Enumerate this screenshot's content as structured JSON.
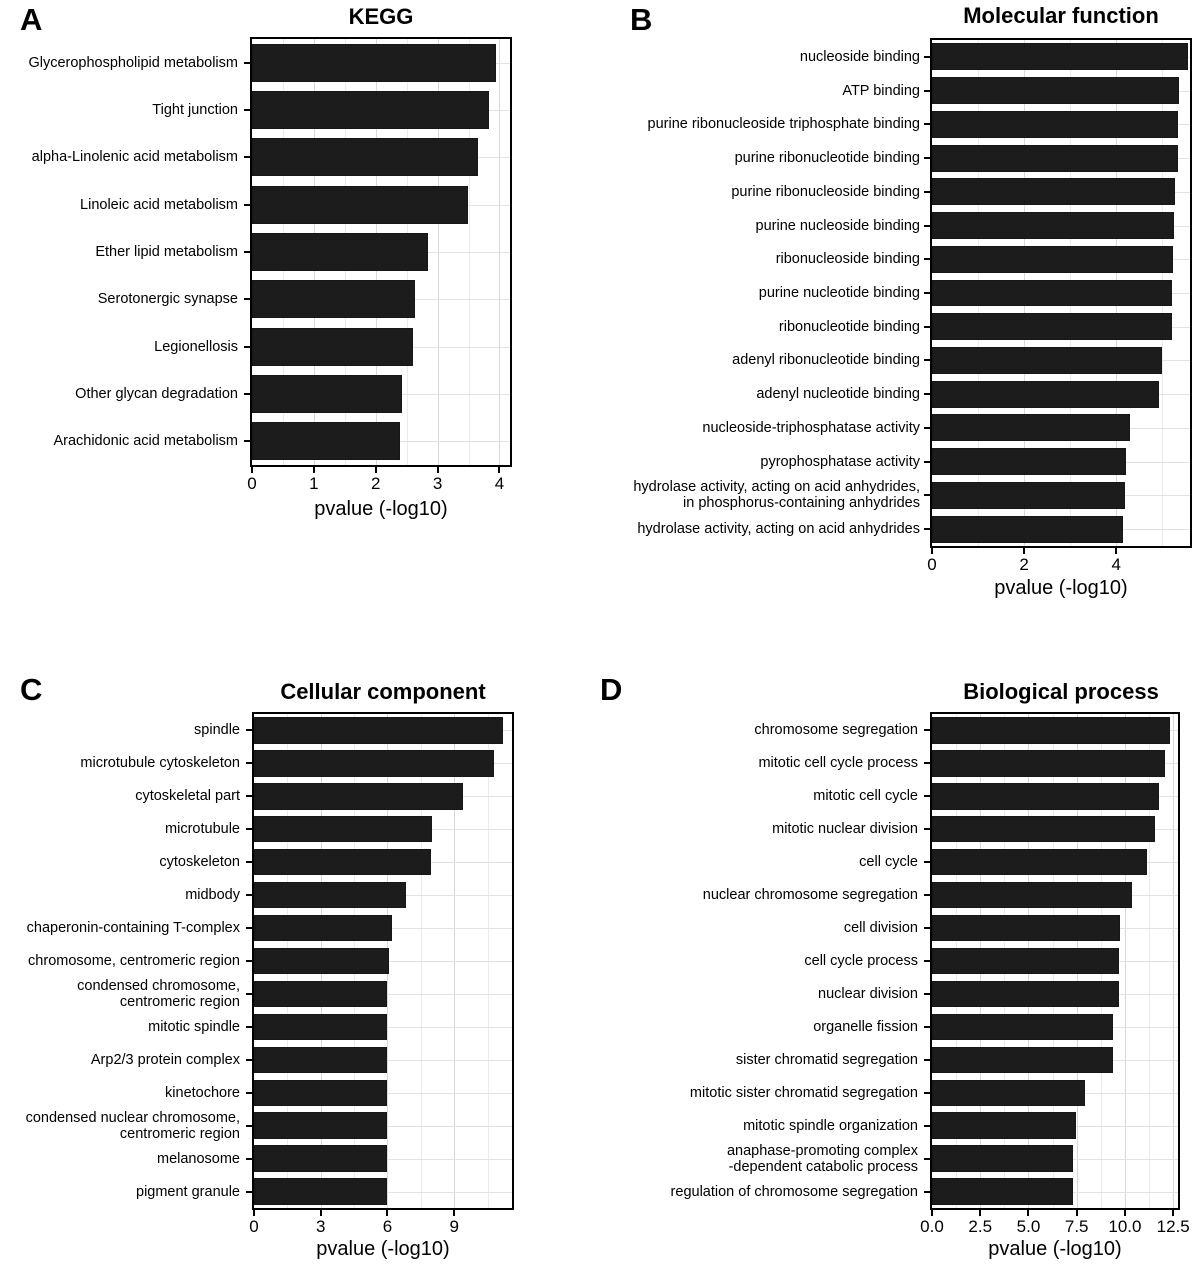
{
  "figure": {
    "panels": [
      {
        "letter": "A",
        "title": "KEGG",
        "xlabel": "pvalue (-log10)"
      },
      {
        "letter": "B",
        "title": "Molecular function",
        "xlabel": "pvalue (-log10)"
      },
      {
        "letter": "C",
        "title": "Cellular component",
        "xlabel": "pvalue (-log10)"
      },
      {
        "letter": "D",
        "title": "Biological process",
        "xlabel": "pvalue (-log10)"
      }
    ]
  },
  "chart_data": [
    {
      "panel": "A",
      "type": "bar",
      "orientation": "horizontal",
      "title": "KEGG",
      "xlabel": "pvalue (-log10)",
      "ylabel": "",
      "xlim": [
        0,
        4.17
      ],
      "xticks": [
        0,
        1,
        2,
        3,
        4
      ],
      "xticklabels": [
        "0",
        "1",
        "2",
        "3",
        "4"
      ],
      "grid": true,
      "legend": null,
      "categories": [
        "Glycerophospholipid metabolism",
        "Tight junction",
        "alpha-Linolenic acid metabolism",
        "Linoleic acid metabolism",
        "Ether lipid metabolism",
        "Serotonergic synapse",
        "Legionellosis",
        "Other glycan degradation",
        "Arachidonic acid metabolism"
      ],
      "values": [
        3.95,
        3.83,
        3.65,
        3.49,
        2.85,
        2.63,
        2.6,
        2.42,
        2.4
      ]
    },
    {
      "panel": "B",
      "type": "bar",
      "orientation": "horizontal",
      "title": "Molecular function",
      "xlabel": "pvalue (-log10)",
      "ylabel": "",
      "xlim": [
        0,
        5.6
      ],
      "xticks": [
        0,
        2,
        4
      ],
      "xticklabels": [
        "0",
        "2",
        "4"
      ],
      "grid": true,
      "legend": null,
      "categories": [
        "nucleoside binding",
        "ATP binding",
        "purine ribonucleoside triphosphate binding",
        "purine ribonucleotide binding",
        "purine ribonucleoside binding",
        "purine nucleoside binding",
        "ribonucleoside binding",
        "purine nucleotide binding",
        "ribonucleotide binding",
        "adenyl ribonucleotide binding",
        "adenyl nucleotide binding",
        "nucleoside-triphosphatase activity",
        "pyrophosphatase activity",
        "hydrolase activity, acting on acid anhydrides,\nin phosphorus-containing anhydrides",
        "hydrolase activity, acting on acid anhydrides"
      ],
      "values": [
        5.55,
        5.37,
        5.35,
        5.33,
        5.27,
        5.25,
        5.24,
        5.22,
        5.2,
        5.0,
        4.92,
        4.3,
        4.2,
        4.18,
        4.15
      ]
    },
    {
      "panel": "C",
      "type": "bar",
      "orientation": "horizontal",
      "title": "Cellular component",
      "xlabel": "pvalue (-log10)",
      "ylabel": "",
      "xlim": [
        0,
        11.6
      ],
      "xticks": [
        0,
        3,
        6,
        9
      ],
      "xticklabels": [
        "0",
        "3",
        "6",
        "9"
      ],
      "grid": true,
      "legend": null,
      "categories": [
        "spindle",
        "microtubule cytoskeleton",
        "cytoskeletal part",
        "microtubule",
        "cytoskeleton",
        "midbody",
        "chaperonin-containing T-complex",
        "chromosome, centromeric region",
        "condensed chromosome,\ncentromeric region",
        "mitotic spindle",
        "Arp2/3 protein complex",
        "kinetochore",
        "condensed nuclear chromosome,\ncentromeric region",
        "melanosome",
        "pigment granule"
      ],
      "values": [
        11.2,
        10.8,
        9.4,
        8.0,
        7.95,
        6.85,
        6.2,
        6.08,
        6.0,
        6.0,
        6.0,
        6.0,
        6.0,
        6.0,
        6.0
      ]
    },
    {
      "panel": "D",
      "type": "bar",
      "orientation": "horizontal",
      "title": "Biological process",
      "xlabel": "pvalue (-log10)",
      "ylabel": "",
      "xlim": [
        0,
        12.75
      ],
      "xticks": [
        0,
        2.5,
        5,
        7.5,
        10,
        12.5
      ],
      "xticklabels": [
        "0.0",
        "2.5",
        "5.0",
        "7.5",
        "10.0",
        "12.5"
      ],
      "grid": true,
      "legend": null,
      "categories": [
        "chromosome segregation",
        "mitotic cell cycle process",
        "mitotic cell cycle",
        "mitotic nuclear division",
        "cell cycle",
        "nuclear chromosome segregation",
        "cell division",
        "cell cycle process",
        "nuclear division",
        "organelle fission",
        "sister chromatid segregation",
        "mitotic sister chromatid segregation",
        "mitotic spindle organization",
        "anaphase-promoting complex\n-dependent catabolic process",
        "regulation of chromosome segregation"
      ],
      "values": [
        12.35,
        12.1,
        11.75,
        11.55,
        11.15,
        10.35,
        9.75,
        9.7,
        9.7,
        9.4,
        9.4,
        7.95,
        7.45,
        7.3,
        7.3
      ]
    }
  ]
}
